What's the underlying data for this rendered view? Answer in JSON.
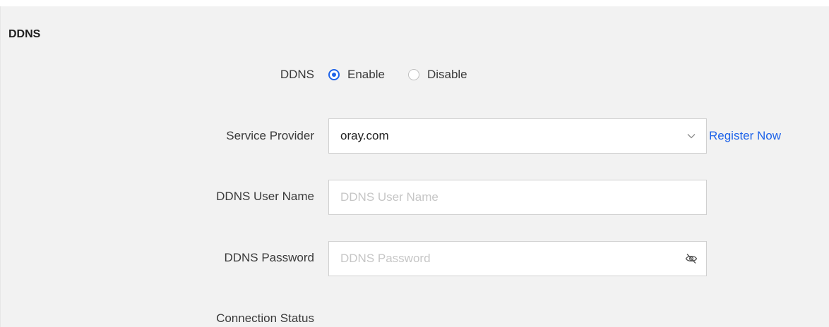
{
  "section": {
    "title": "DDNS"
  },
  "ddns": {
    "label": "DDNS",
    "options": [
      {
        "label": "Enable",
        "checked": true
      },
      {
        "label": "Disable",
        "checked": false
      }
    ]
  },
  "service_provider": {
    "label": "Service Provider",
    "value": "oray.com",
    "register_link": "Register Now"
  },
  "username": {
    "label": "DDNS User Name",
    "placeholder": "DDNS User Name",
    "value": ""
  },
  "password": {
    "label": "DDNS Password",
    "placeholder": "DDNS Password",
    "value": ""
  },
  "connection_status": {
    "label": "Connection Status"
  },
  "colors": {
    "accent": "#1e63e9",
    "panel_bg": "#f2f2f2"
  },
  "icons": {
    "dropdown": "chevron-down-icon",
    "password_toggle": "eye-off-icon"
  }
}
